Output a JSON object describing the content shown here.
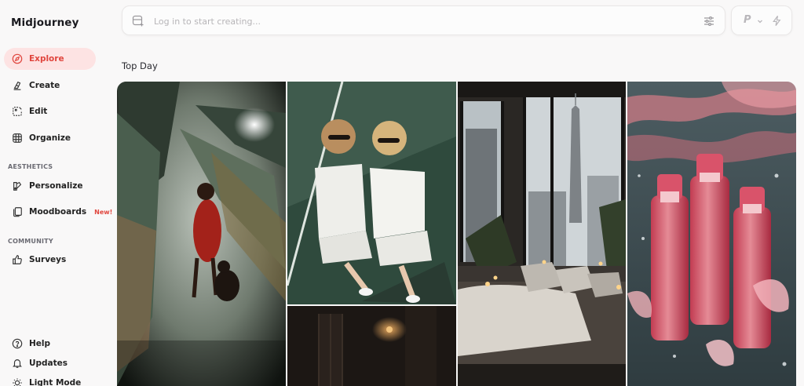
{
  "sidebar": {
    "brand": "Midjourney",
    "nav": [
      {
        "label": "Explore",
        "icon": "compass-icon",
        "active": true
      },
      {
        "label": "Create",
        "icon": "brush-icon"
      },
      {
        "label": "Edit",
        "icon": "edit-frame-icon"
      },
      {
        "label": "Organize",
        "icon": "grid-icon"
      }
    ],
    "aesthetics_label": "AESTHETICS",
    "aesthetics": [
      {
        "label": "Personalize",
        "icon": "personalize-icon"
      },
      {
        "label": "Moodboards",
        "icon": "moodboard-icon",
        "badge": "New!"
      }
    ],
    "community_label": "COMMUNITY",
    "community": [
      {
        "label": "Surveys",
        "icon": "thumbs-up-icon"
      }
    ],
    "footer": [
      {
        "label": "Help",
        "icon": "help-icon"
      },
      {
        "label": "Updates",
        "icon": "bell-icon"
      },
      {
        "label": "Light Mode",
        "icon": "sun-icon"
      }
    ]
  },
  "search": {
    "placeholder": "Log in to start creating..."
  },
  "profile": {
    "letter": "P"
  },
  "main": {
    "section_title": "Top Day"
  },
  "colors": {
    "accent": "#e0463e",
    "active_bg": "#fde3e3",
    "background": "#f9f8f8"
  }
}
